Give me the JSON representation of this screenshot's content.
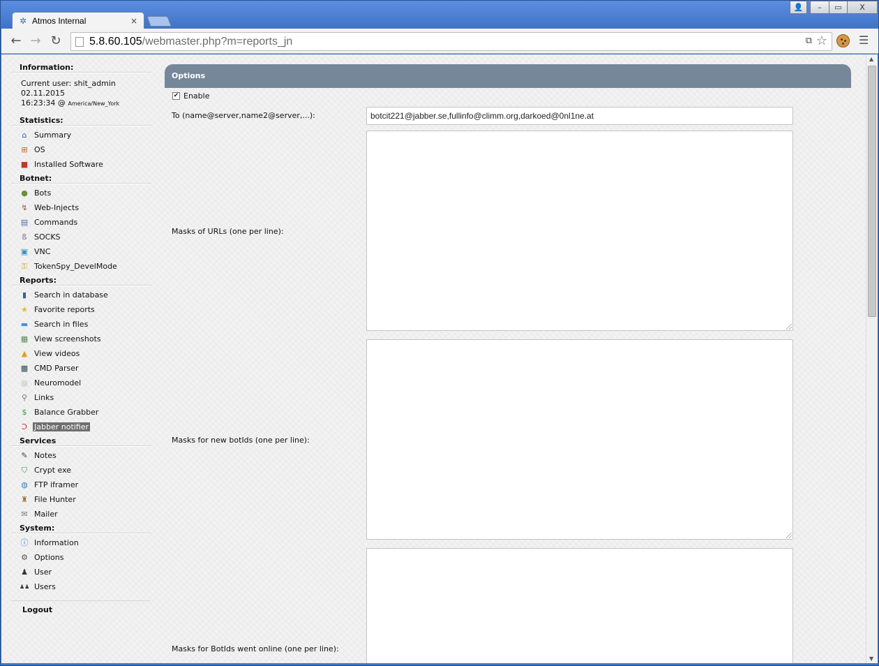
{
  "browser": {
    "tab_title": "Atmos Internal",
    "tab_close": "×",
    "address_host": "5.8.60.105",
    "address_path": "/webmaster.php?m=reports_jn",
    "controls": {
      "profile": "👤",
      "minimize": "–",
      "maximize": "▭",
      "close": "X"
    },
    "icons": {
      "back": "arrow-left-icon",
      "forward": "arrow-right-icon",
      "reload": "reload-icon",
      "star": "star-icon",
      "translate": "translate-icon",
      "cookie": "cookie-icon",
      "menu": "hamburger-menu-icon"
    }
  },
  "sidebar": {
    "information": {
      "title": "Information:",
      "current_user": "Current user: shit_admin",
      "date": "02.11.2015",
      "time": "16:23:34 @",
      "timezone": "America/New_York"
    },
    "statistics": {
      "title": "Statistics:",
      "items": [
        {
          "label": "Summary",
          "icon": "home-icon"
        },
        {
          "label": "OS",
          "icon": "windows-icon"
        },
        {
          "label": "Installed Software",
          "icon": "software-icon"
        }
      ]
    },
    "botnet": {
      "title": "Botnet:",
      "items": [
        {
          "label": "Bots",
          "icon": "user-icon"
        },
        {
          "label": "Web-Injects",
          "icon": "injection-icon"
        },
        {
          "label": "Commands",
          "icon": "clipboard-icon"
        },
        {
          "label": "SOCKS",
          "icon": "socks-icon"
        },
        {
          "label": "VNC",
          "icon": "monitor-icon"
        },
        {
          "label": "TokenSpy_DevelMode",
          "icon": "key-icon"
        }
      ]
    },
    "reports": {
      "title": "Reports:",
      "items": [
        {
          "label": "Search in database",
          "icon": "book-icon"
        },
        {
          "label": "Favorite reports",
          "icon": "star-icon"
        },
        {
          "label": "Search in files",
          "icon": "folder-icon"
        },
        {
          "label": "View screenshots",
          "icon": "screenshot-icon"
        },
        {
          "label": "View videos",
          "icon": "video-icon"
        },
        {
          "label": "CMD Parser",
          "icon": "console-icon"
        },
        {
          "label": "Neuromodel",
          "icon": "neuromodel-icon"
        },
        {
          "label": "Links",
          "icon": "magnifier-icon"
        },
        {
          "label": "Balance Grabber",
          "icon": "dollar-icon"
        },
        {
          "label": "Jabber notifier",
          "icon": "jabber-icon",
          "active": true
        }
      ]
    },
    "services": {
      "title": "Services",
      "items": [
        {
          "label": "Notes",
          "icon": "pen-icon"
        },
        {
          "label": "Crypt exe",
          "icon": "shield-icon"
        },
        {
          "label": "FTP iframer",
          "icon": "ftp-icon"
        },
        {
          "label": "File Hunter",
          "icon": "file-hunter-icon"
        },
        {
          "label": "Mailer",
          "icon": "envelope-icon"
        }
      ]
    },
    "system": {
      "title": "System:",
      "items": [
        {
          "label": "Information",
          "icon": "info-icon"
        },
        {
          "label": "Options",
          "icon": "gear-icon"
        },
        {
          "label": "User",
          "icon": "user-silhouette-icon"
        },
        {
          "label": "Users",
          "icon": "users-icon"
        }
      ]
    },
    "logout": "Logout"
  },
  "main": {
    "header": "Options",
    "enable_label": "Enable",
    "enable_checked": true,
    "to_label": "To (name@server,name2@server,...):",
    "to_value": "botcit221@jabber.se,fullinfo@climm.org,darkoed@0nl1ne.at",
    "masks_urls_label": "Masks of URLs (one per line):",
    "masks_botids_label": "Masks for new botIds (one per line):",
    "masks_online_label": "Masks for BotIds went online (one per line):"
  },
  "colors": {
    "header_bg": "#76879a",
    "window_frame": "#4a7fd0",
    "active_item_bg": "#6e6e6e"
  }
}
